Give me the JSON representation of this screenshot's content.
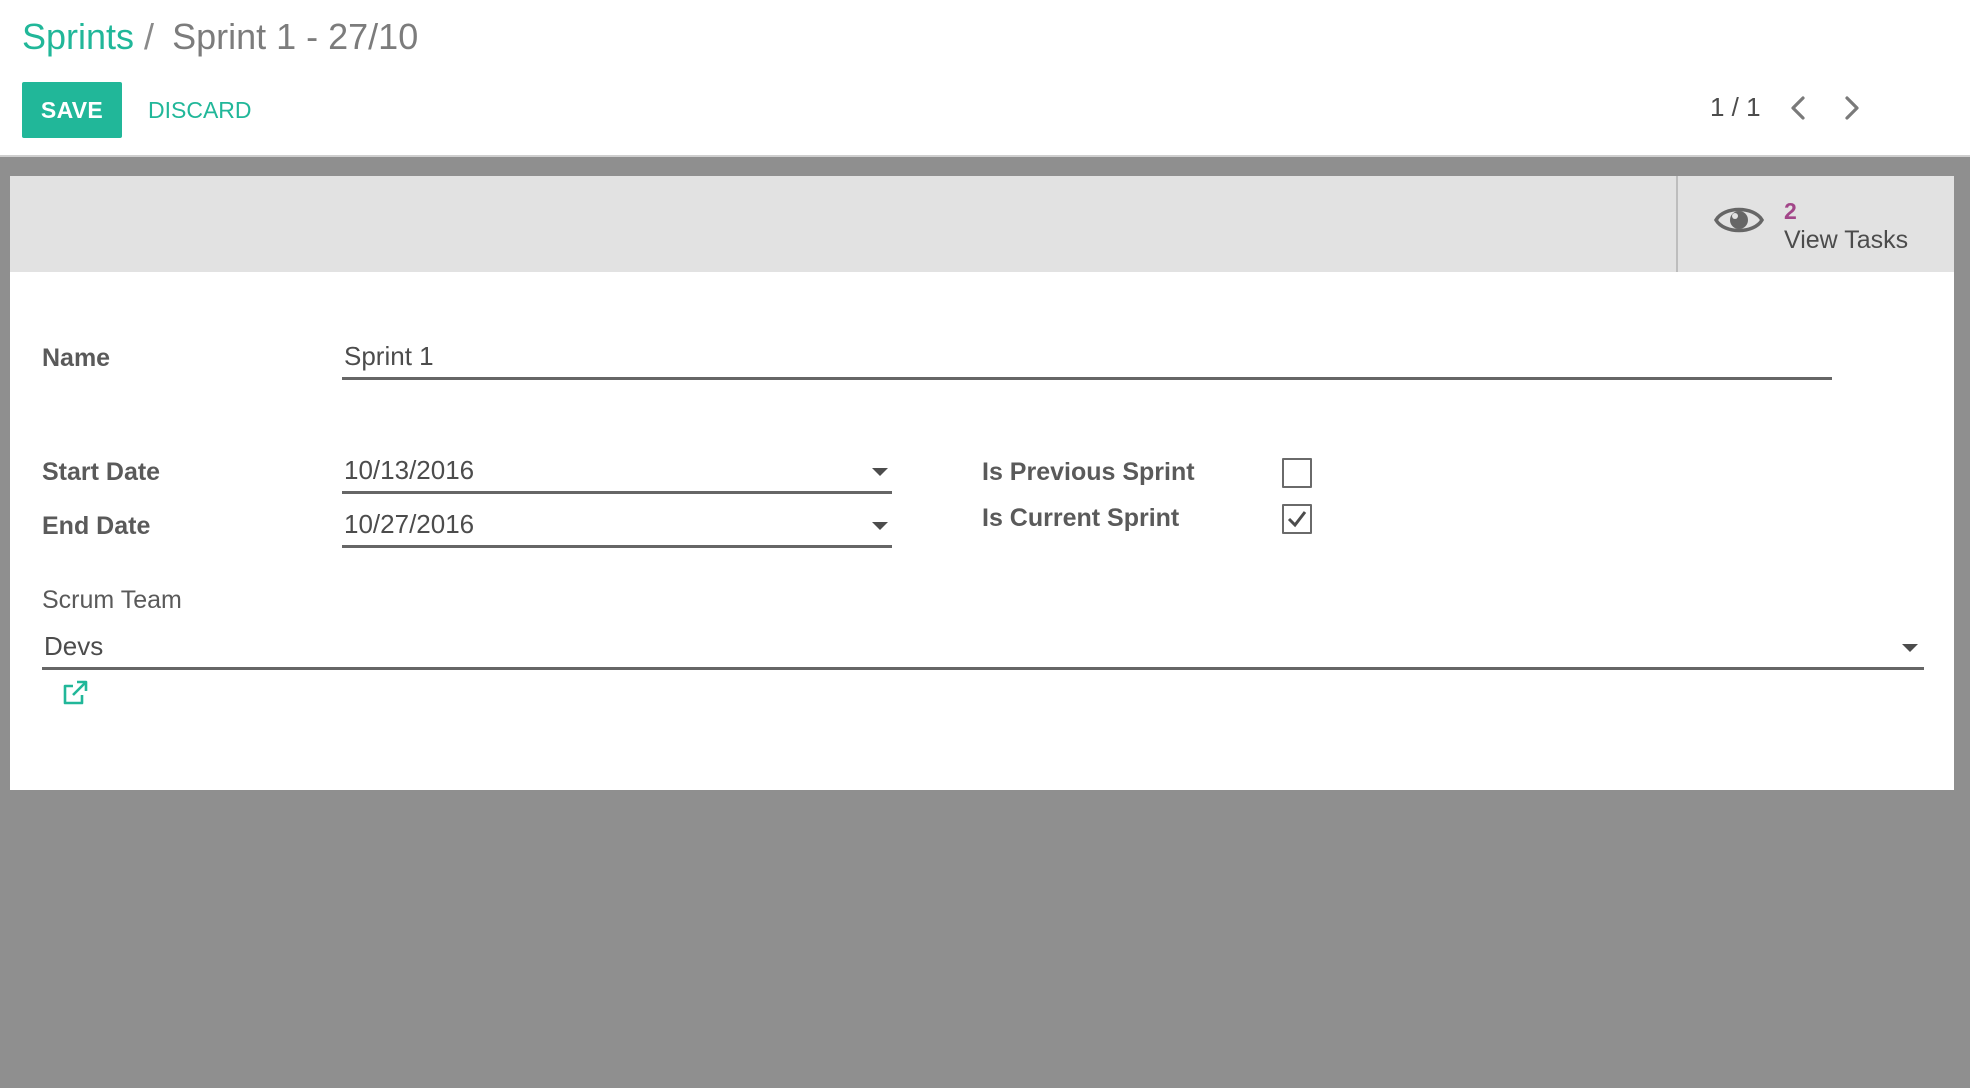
{
  "breadcrumb": {
    "parent": "Sprints",
    "separator": "/",
    "current": "Sprint 1 - 27/10"
  },
  "toolbar": {
    "save_label": "SAVE",
    "discard_label": "DISCARD"
  },
  "pager": {
    "value": "1 / 1"
  },
  "stat_button": {
    "icon": "eye-icon",
    "count": "2",
    "label": "View Tasks"
  },
  "form": {
    "name": {
      "label": "Name",
      "value": "Sprint 1"
    },
    "start_date": {
      "label": "Start Date",
      "value": "10/13/2016"
    },
    "end_date": {
      "label": "End Date",
      "value": "10/27/2016"
    },
    "is_previous_sprint": {
      "label": "Is Previous Sprint",
      "checked": false
    },
    "is_current_sprint": {
      "label": "Is Current Sprint",
      "checked": true
    },
    "scrum_team": {
      "label": "Scrum Team",
      "value": "Devs"
    }
  },
  "colors": {
    "brand": "#21b799",
    "stat_count": "#a24689",
    "backdrop": "#8f8f8f",
    "button_box": "#e2e2e2"
  }
}
